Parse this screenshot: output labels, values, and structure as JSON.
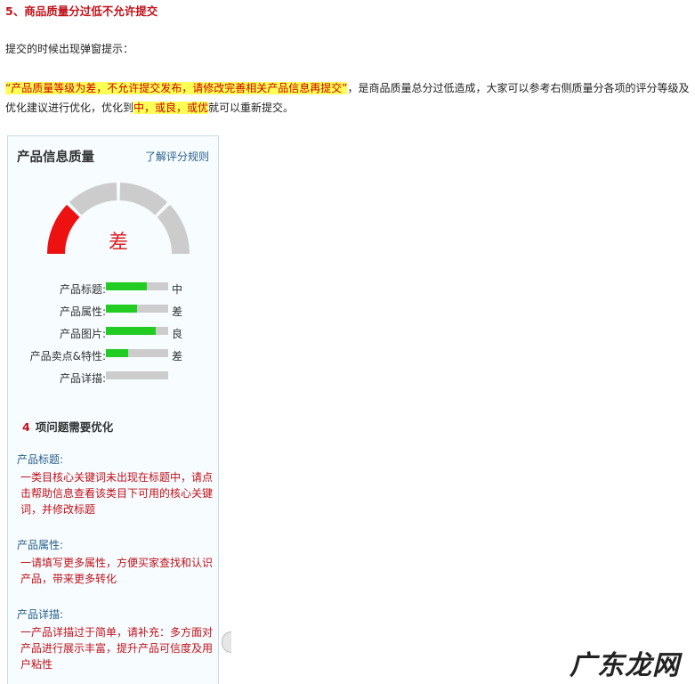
{
  "article": {
    "heading": "5、商品质量分过低不允许提交",
    "intro": "提交的时候出现弹窗提示：",
    "quote": "“产品质量等级为差，不允许提交发布，请修改完善相关产品信息再提交”",
    "mid": "，是商品质量总分过低造成，大家可以参考右侧质量分各项的评分等级及优化建议进行优化，优化到",
    "hl_mid": "中，或良，或优",
    "tail": "就可以重新提交。"
  },
  "panel": {
    "title": "产品信息质量",
    "rules_link": "了解评分规则",
    "grade": "差",
    "grade_level": 1,
    "grade_segments": 4,
    "colors": {
      "active": "#ee1111",
      "inactive": "#cccccc",
      "bar": "#22cc22"
    },
    "metrics": [
      {
        "label": "产品标题:",
        "fill": 0.65,
        "level": "中"
      },
      {
        "label": "产品属性:",
        "fill": 0.5,
        "level": "差"
      },
      {
        "label": "产品图片:",
        "fill": 0.8,
        "level": "良"
      },
      {
        "label": "产品卖点&特性:",
        "fill": 0.35,
        "level": "差"
      },
      {
        "label": "产品详描:",
        "fill": 0,
        "level": ""
      }
    ],
    "issues_count": "4",
    "issues_label": "项问题需要优化",
    "issues": [
      {
        "title": "产品标题:",
        "lines": [
          "一类目核心关键词未出现在标题中，请点",
          "击帮助信息查看该类目下可用的核心关键",
          "词，并修改标题"
        ]
      },
      {
        "title": "产品属性:",
        "lines": [
          "一请填写更多属性，方便买家查找和认识",
          "产品，带来更多转化"
        ]
      },
      {
        "title": "产品详描:",
        "lines": [
          "一产品详描过于简单，请补充：多方面对",
          "产品进行展示丰富，提升产品可信度及用",
          "户粘性"
        ]
      }
    ]
  },
  "watermark": "广东龙网"
}
